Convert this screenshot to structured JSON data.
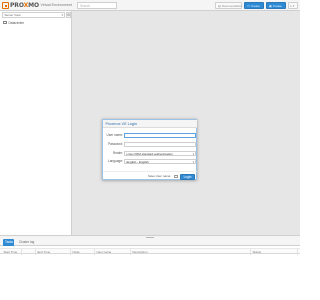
{
  "header": {
    "logo": {
      "part1": "PRO",
      "part2": "X",
      "part3": "MO",
      "subtitle": "Virtual Environment"
    },
    "search": {
      "placeholder": "Search"
    },
    "buttons": {
      "documentation": "Documentation",
      "create_vm": "Create VM",
      "create_ct": "Create CT",
      "user_menu": "▾"
    }
  },
  "sidebar": {
    "view_selector": {
      "value": "Server View"
    },
    "tree": [
      {
        "label": "Datacenter"
      }
    ]
  },
  "bottom_panel": {
    "tabs": [
      {
        "label": "Tasks",
        "active": true
      },
      {
        "label": "Cluster log",
        "active": false
      }
    ],
    "columns": [
      "Start Time",
      "",
      "End Time",
      "Node",
      "User name",
      "Description",
      "Status"
    ]
  },
  "login_dialog": {
    "title": "Proxmox VE Login",
    "fields": {
      "username": {
        "label": "User name:",
        "value": ""
      },
      "password": {
        "label": "Password:",
        "value": ""
      },
      "realm": {
        "label": "Realm:",
        "value": "Linux PAM standard authentication"
      },
      "language": {
        "label": "Language:",
        "value": "English - English"
      }
    },
    "save_username_label": "Save User name:",
    "save_username_checked": false,
    "login_button": "Login"
  },
  "colors": {
    "accent": "#2f8ad4",
    "logo_orange": "#e57000",
    "background": "#e6e6e6"
  }
}
